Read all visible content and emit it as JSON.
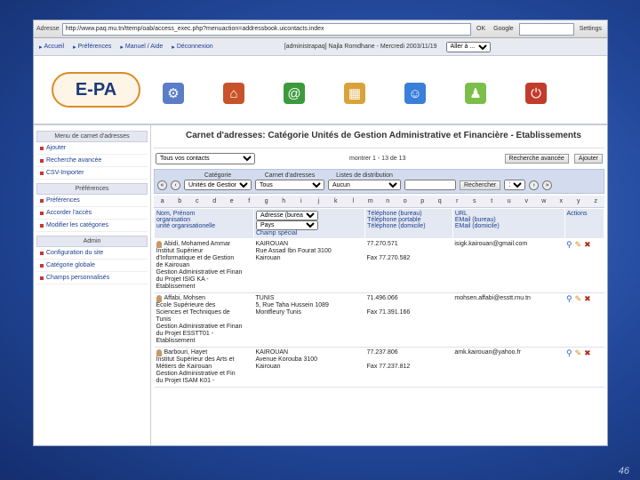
{
  "browser": {
    "address_label": "Adresse",
    "url": "http://www.paq.mu.tn/ttemp/oab/access_exec.php?menuaction=addressbook.uicontacts.index",
    "go_label": "OK",
    "google_label": "Google",
    "settings_label": "Settings"
  },
  "topnav": {
    "links": [
      "Accueil",
      "Préférences",
      "Manuel / Aide",
      "Déconnexion"
    ],
    "user_info": "[administrapaq] Najla Romdhane - Mercredi 2003/11/19",
    "go_select": "Aller à ..."
  },
  "logo_text": "E-PA",
  "sidebar": {
    "header_main": "Menu de carnet d'adresses",
    "main_items": [
      "Ajouter",
      "Recherche avancée",
      "CSV-Importer"
    ],
    "header_prefs": "Préférences",
    "pref_items": [
      "Préférences",
      "Accorder l'accès",
      "Modifier les catégories"
    ],
    "header_admin": "Admin",
    "admin_items": [
      "Configuration du site",
      "Catégorie globale",
      "Champs personnalisés"
    ]
  },
  "main": {
    "title": "Carnet d'adresses: Catégorie Unités de Gestion Administrative et Financière - Etablissements",
    "filter_select": "Tous vos contacts",
    "showing": "montrer 1 - 13 de 13",
    "advanced_search": "Recherche avancée",
    "add_button": "Ajouter",
    "filter": {
      "category_label": "Catégorie",
      "category_value": "Unités de Gestion Admi",
      "addressbook_label": "Carnet d'adresses",
      "addressbook_value": "Tous",
      "distribution_label": "Listes de distribution",
      "distribution_value": "Aucun",
      "search_button": "Rechercher",
      "page_size": "15"
    },
    "alphabet": [
      "a",
      "b",
      "c",
      "d",
      "e",
      "f",
      "g",
      "h",
      "i",
      "j",
      "k",
      "l",
      "m",
      "n",
      "o",
      "p",
      "q",
      "r",
      "s",
      "t",
      "u",
      "v",
      "w",
      "x",
      "y",
      "z"
    ],
    "headers": {
      "col1": "Nom, Prénom\norganisation\nunité organisationelle",
      "col2_select": "Adresse (bureau)",
      "col2_sub": "Pays",
      "col2_extra": "Champ spécial",
      "col3": "Téléphone (bureau)\nTéléphone portable\nTéléphone (domicile)",
      "col4": "URL\nEMail (bureau)\nEMail (domicile)",
      "col5": "Actions"
    },
    "rows": [
      {
        "name": "Abidi, Mohamed Ammar\nInstitut Supérieur\nd'Informatique et de Gestion\nde Kairouan\nGestion Administrative et Finan\ndu Projet ISIG KA -\nEtablissement",
        "address": "KAIROUAN\nRue Assad Ibn Fourat 3100\nKairouan",
        "phones": "77.270.571\n\nFax 77.270.582",
        "email": "isigk.kairouan@gmail.com"
      },
      {
        "name": "Affabi, Mohsen\nEcole Supérieure des\nSciences et Techniques de\nTunis\nGestion Administrative et Finan\ndu Projet ESSTT01 -\nEtablissement",
        "address": "TUNIS\n5, Rue Taha Hussein 1089\nMontfleury Tunis",
        "phones": "71.496.066\n\nFax 71.391.166",
        "email": "mohsen.affabi@esstt.rnu.tn"
      },
      {
        "name": "Barbouri, Hayet\nInstitut Supérieur des Arts et\nMétiers de Kairouan\nGestion Administrative et Fin\ndu Projet ISAM K01 -",
        "address": "KAIROUAN\nAvenue Korouba 3100\nKairouan",
        "phones": "77.237.806\n\nFax 77.237.812",
        "email": "amk.kairouan@yahoo.fr"
      }
    ]
  },
  "slide_number": "46"
}
